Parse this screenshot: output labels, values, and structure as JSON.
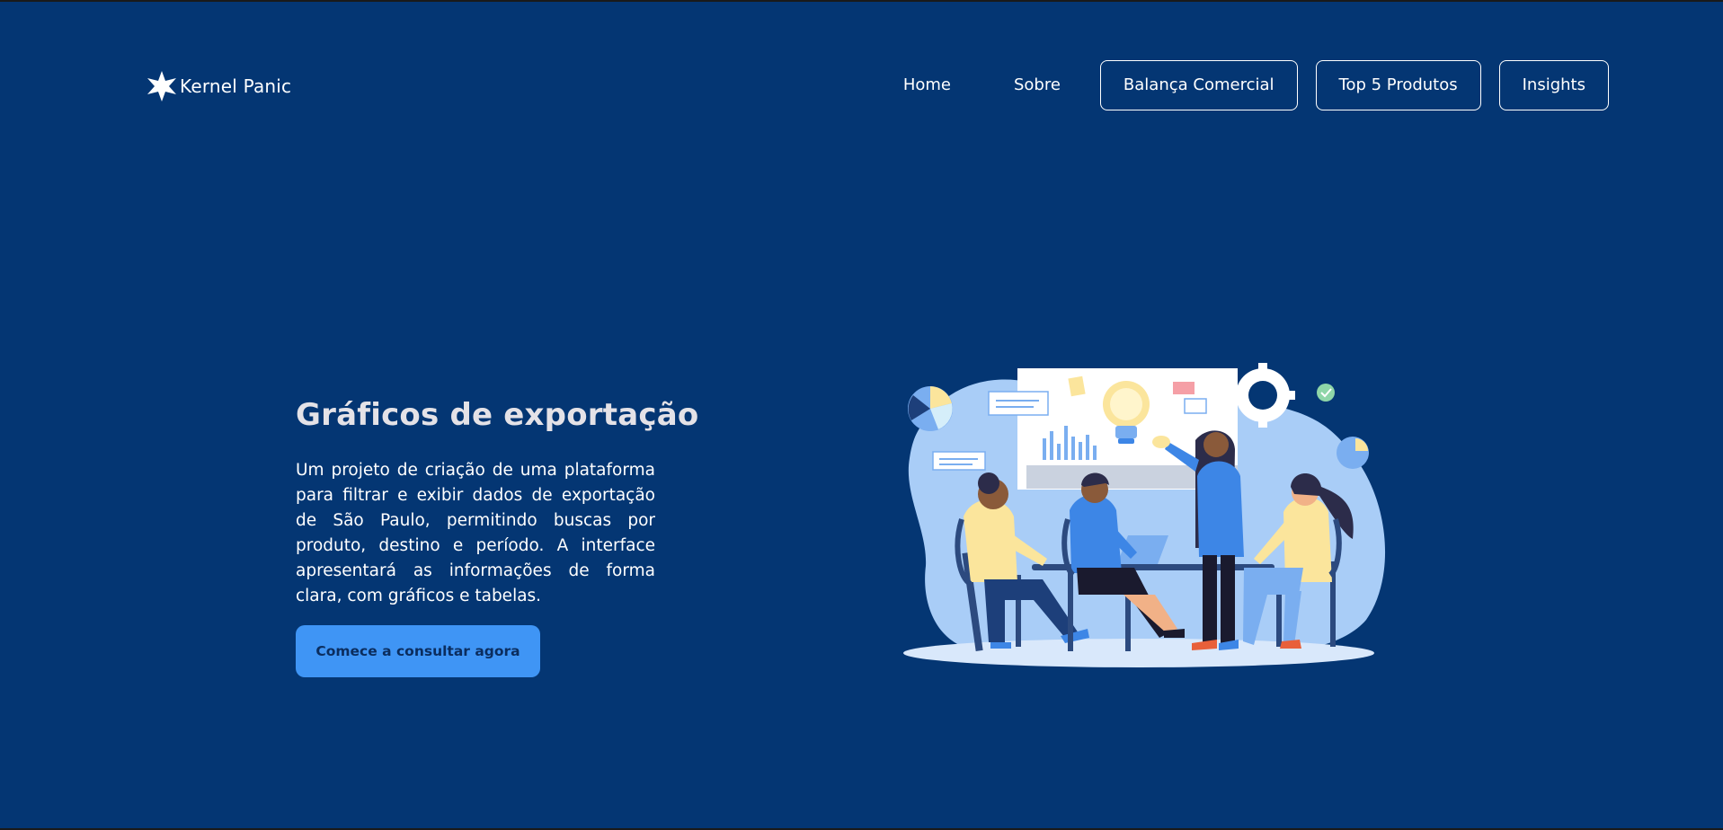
{
  "header": {
    "logo_text": "Kernel Panic",
    "nav_links": [
      "Home",
      "Sobre"
    ],
    "nav_buttons": [
      "Balança Comercial",
      "Top 5 Produtos",
      "Insights"
    ]
  },
  "hero": {
    "title": "Gráficos de exportação",
    "description": "Um projeto de criação de uma plataforma para filtrar e exibir dados de exportação de São Paulo, permitindo buscas por produto, destino e período. A interface apresentará as informações de forma clara, com gráficos e tabelas.",
    "cta_label": "Comece a consultar agora"
  },
  "colors": {
    "background": "#043673",
    "accent": "#3f95f5",
    "illustration_blob": "#a9cdf7",
    "figure_blue": "#3d86e6",
    "figure_yellow": "#fbe59c"
  },
  "icons": {
    "logo": "star-icon",
    "illustration": "team-meeting-illustration"
  }
}
